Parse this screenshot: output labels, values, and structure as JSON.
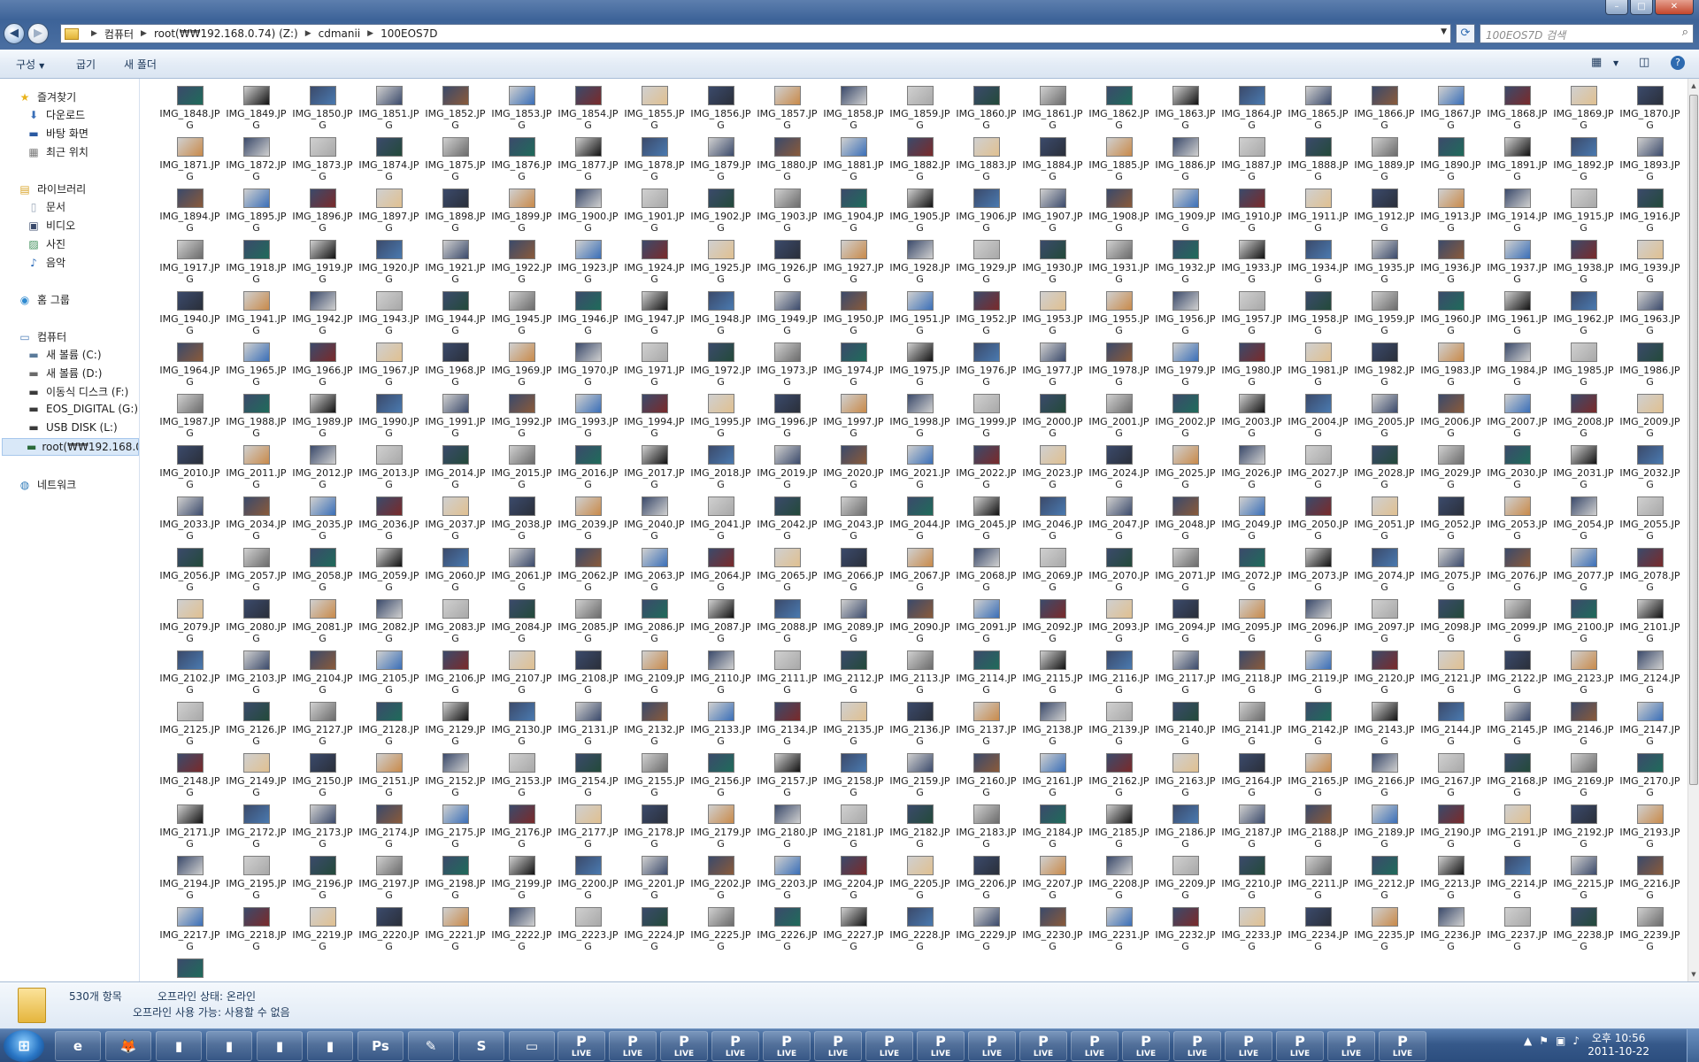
{
  "window": {
    "minimize": "–",
    "maximize": "□",
    "close": "✕"
  },
  "nav_buttons": {
    "back": "◀",
    "forward": "▶"
  },
  "address": {
    "crumbs": [
      "컴퓨터",
      "root(₩₩192.168.0.74) (Z:)",
      "cdmanii",
      "100EOS7D"
    ],
    "dropdown": "▼",
    "refresh": "⟳"
  },
  "search": {
    "placeholder": "100EOS7D 검색",
    "icon": "⌕"
  },
  "commandbar": {
    "organize": "구성",
    "organize_dd": "▼",
    "burn": "굽기",
    "new_folder": "새 폴더",
    "view_icon": "▦",
    "view_dd": "▼",
    "preview_icon": "◫",
    "help_icon": "?"
  },
  "navpane": {
    "favorites": {
      "label": "즐겨찾기",
      "items": [
        "다운로드",
        "바탕 화면",
        "최근 위치"
      ]
    },
    "libraries": {
      "label": "라이브러리",
      "items": [
        "문서",
        "비디오",
        "사진",
        "음악"
      ]
    },
    "homegroup": "홈 그룹",
    "computer": {
      "label": "컴퓨터",
      "items": [
        "새 볼륨 (C:)",
        "새 볼륨 (D:)",
        "이동식 디스크 (F:)",
        "EOS_DIGITAL (G:)",
        "USB DISK (L:)",
        "root(₩₩192.168.0.74) (Z:)"
      ]
    },
    "network": "네트워크"
  },
  "files": {
    "prefix": "IMG_",
    "first": 1848,
    "count": 392,
    "skip": [
      1954
    ],
    "ext": ".JPG",
    "palette": [
      "#3b4a6b",
      "#2a2f3a",
      "#6b6b6b",
      "#8a5a3a",
      "#c98a4a",
      "#1f6b5a",
      "#3a6fb8",
      "#d0d0d0",
      "#111111",
      "#7a2a2a",
      "#a8a8a8",
      "#4a7ab0",
      "#e0c090",
      "#234a3a"
    ]
  },
  "details": {
    "count": "530개 항목",
    "offline_status": "오프라인 상태: 온라인",
    "offline_avail": "오프라인 사용 가능: 사용할 수 없음"
  },
  "taskbar": {
    "start": "⊞",
    "pinned": [
      "e",
      "🦊",
      "▮",
      "▮",
      "▮",
      "▮",
      "Ps",
      "✎",
      "S",
      "▭"
    ],
    "live_label": "LIVE",
    "live_glyph": "P",
    "live_count": 17,
    "tray_icons": [
      "▲",
      "⚑",
      "▣",
      "♪"
    ],
    "clock_time": "오후 10:56",
    "clock_date": "2011-10-22"
  }
}
